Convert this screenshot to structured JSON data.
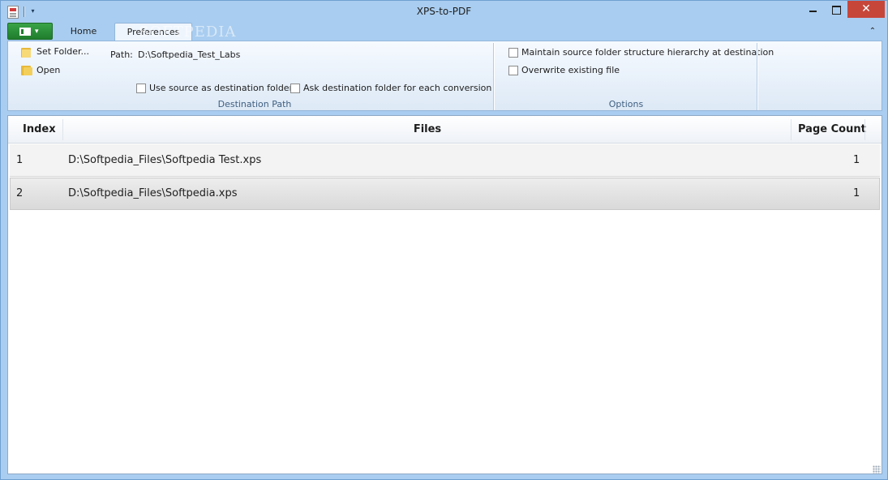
{
  "window": {
    "title": "XPS-to-PDF",
    "close_glyph": "✕"
  },
  "quick_access": {
    "dropdown_glyph": "▾"
  },
  "tabs": {
    "app_menu_caret": "▾",
    "home": "Home",
    "preferences": "Preferences",
    "collapse_glyph": "⌃"
  },
  "watermark": "SOFTPEDIA",
  "ribbon": {
    "destination_group": {
      "set_folder_label": "Set Folder...",
      "open_label": "Open",
      "path_label": "Path:",
      "path_value": "D:\\Softpedia_Test_Labs",
      "use_source_label": "Use source as destination folder",
      "ask_destination_label": "Ask destination folder for each conversion",
      "group_label": "Destination Path"
    },
    "options_group": {
      "maintain_hierarchy_label": "Maintain source folder structure hierarchy at destination",
      "overwrite_label": "Overwrite existing file",
      "group_label": "Options"
    }
  },
  "grid": {
    "columns": [
      "Index",
      "Files",
      "Page Count"
    ],
    "rows": [
      {
        "index": "1",
        "file": "D:\\Softpedia_Files\\Softpedia Test.xps",
        "page_count": "1"
      },
      {
        "index": "2",
        "file": "D:\\Softpedia_Files\\Softpedia.xps",
        "page_count": "1"
      }
    ]
  },
  "colors": {
    "frame": "#a9cdf0",
    "close_button": "#c7463a",
    "app_menu": "#2a8f39",
    "group_label": "#3f5f80"
  },
  "icons": [
    "app-icon",
    "folder-icon",
    "open-folder-icon",
    "minimize-icon",
    "maximize-icon",
    "close-icon",
    "ribbon-collapse-icon",
    "app-menu-icon",
    "resize-grip-icon"
  ]
}
